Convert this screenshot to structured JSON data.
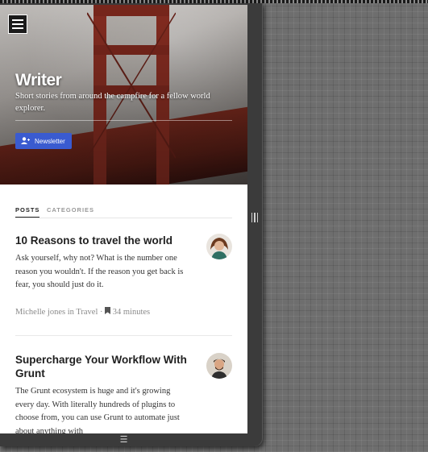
{
  "site": {
    "title": "Writer",
    "tagline": "Short stories from around the campfire for a fellow world explorer.",
    "newsletter_label": "Newsletter"
  },
  "tabs": [
    {
      "label": "POSTS",
      "active": true
    },
    {
      "label": "CATEGORIES",
      "active": false
    }
  ],
  "posts": [
    {
      "title": "10 Reasons to travel the world",
      "excerpt": "Ask yourself, why not? What is the number one reason you wouldn't. If the reason you get back is fear, you should just do it.",
      "author": "Michelle jones",
      "category_prefix": "in",
      "category": "Travel",
      "separator": "·",
      "read_time": "34 minutes"
    },
    {
      "title": "Supercharge Your Workflow With Grunt",
      "excerpt": "The Grunt ecosystem is huge and it's growing every day. With literally hundreds of plugins to choose from, you can use Grunt to automate just about anything with"
    }
  ],
  "icons": {
    "menu": "hamburger-icon",
    "newsletter": "user-plus-icon",
    "bookmark": "bookmark-icon",
    "scroll_grip": "vertical-grip-icon",
    "bottom_handle": "horizontal-grip-icon"
  },
  "colors": {
    "accent": "#3a5bd0",
    "title": "#1f1f1f",
    "meta": "#8a8a8a"
  }
}
